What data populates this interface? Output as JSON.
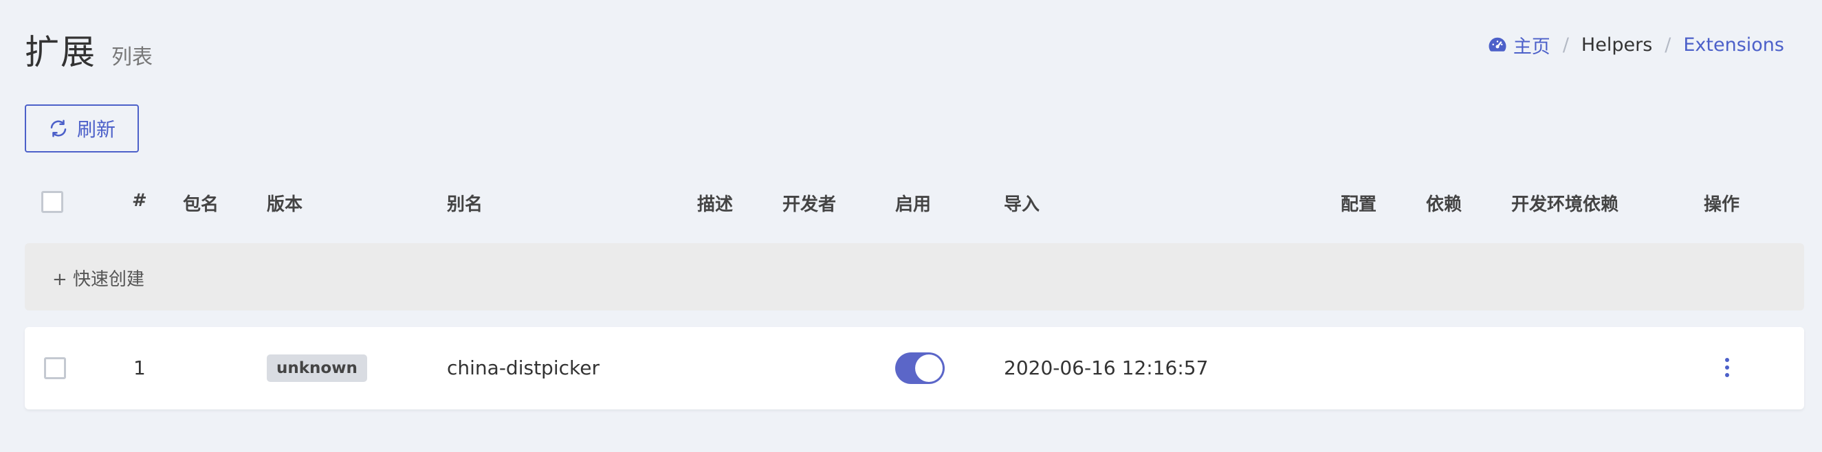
{
  "header": {
    "title": "扩展",
    "subtitle": "列表"
  },
  "breadcrumb": {
    "home": "主页",
    "item1": "Helpers",
    "item2": "Extensions",
    "sep": "/"
  },
  "toolbar": {
    "refresh_label": "刷新"
  },
  "table": {
    "headers": [
      "#",
      "包名",
      "版本",
      "别名",
      "描述",
      "开发者",
      "启用",
      "导入",
      "配置",
      "依赖",
      "开发环境依赖",
      "操作"
    ],
    "quick_create": "+ 快速创建",
    "rows": [
      {
        "id": "1",
        "package": "",
        "version": "unknown",
        "alias": "china-distpicker",
        "description": "",
        "developer": "",
        "enabled": true,
        "imported": "2020-06-16 12:16:57"
      }
    ]
  },
  "colors": {
    "accent": "#4c60c9",
    "toggle_on": "#5b66c8",
    "background": "#eff2f7"
  }
}
